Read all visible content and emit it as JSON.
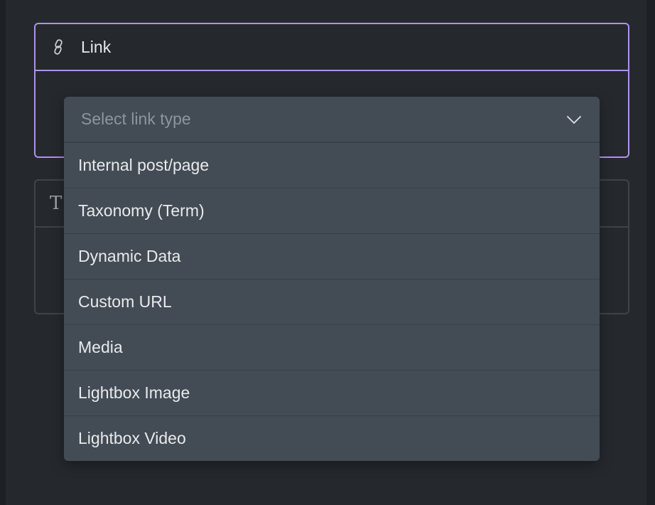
{
  "link_card": {
    "title": "Link",
    "icon": "link-icon"
  },
  "text_card": {
    "icon": "text-icon",
    "icon_glyph": "T"
  },
  "select": {
    "placeholder": "Select link type",
    "options": [
      "Internal post/page",
      "Taxonomy (Term)",
      "Dynamic Data",
      "Custom URL",
      "Media",
      "Lightbox Image",
      "Lightbox Video"
    ]
  },
  "colors": {
    "accent": "#b090f0",
    "panel": "#25292d",
    "dropdown": "#434c55"
  }
}
